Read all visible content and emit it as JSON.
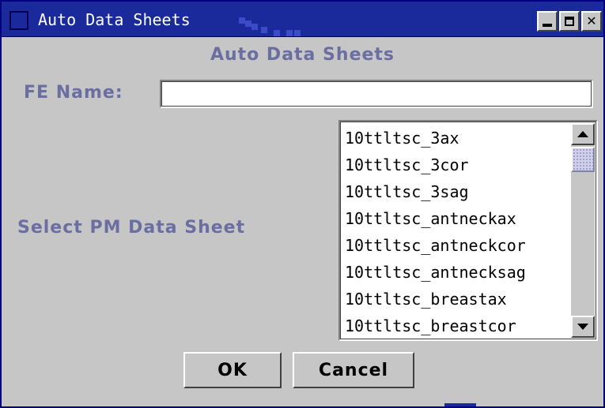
{
  "window": {
    "title": "Auto Data Sheets",
    "buttons": [
      "minimize",
      "maximize",
      "close"
    ],
    "titlebar_color": "#1b2a9a",
    "background_color": "#c6c6c6"
  },
  "dialog": {
    "header": "Auto Data Sheets",
    "label_color": "#6b6ea0"
  },
  "fe_name": {
    "label": "FE Name:",
    "value": ""
  },
  "data_sheet": {
    "label": "Select PM Data Sheet",
    "items": [
      "10ttltsc_3ax",
      "10ttltsc_3cor",
      "10ttltsc_3sag",
      "10ttltsc_antneckax",
      "10ttltsc_antneckcor",
      "10ttltsc_antnecksag",
      "10ttltsc_breastax",
      "10ttltsc_breastcor"
    ]
  },
  "actions": {
    "ok_label": "OK",
    "cancel_label": "Cancel"
  },
  "icons": {
    "minimize": "minimize-icon",
    "maximize": "maximize-icon",
    "close": "close-icon",
    "scroll_up": "arrow-up-icon",
    "scroll_down": "arrow-down-icon"
  }
}
